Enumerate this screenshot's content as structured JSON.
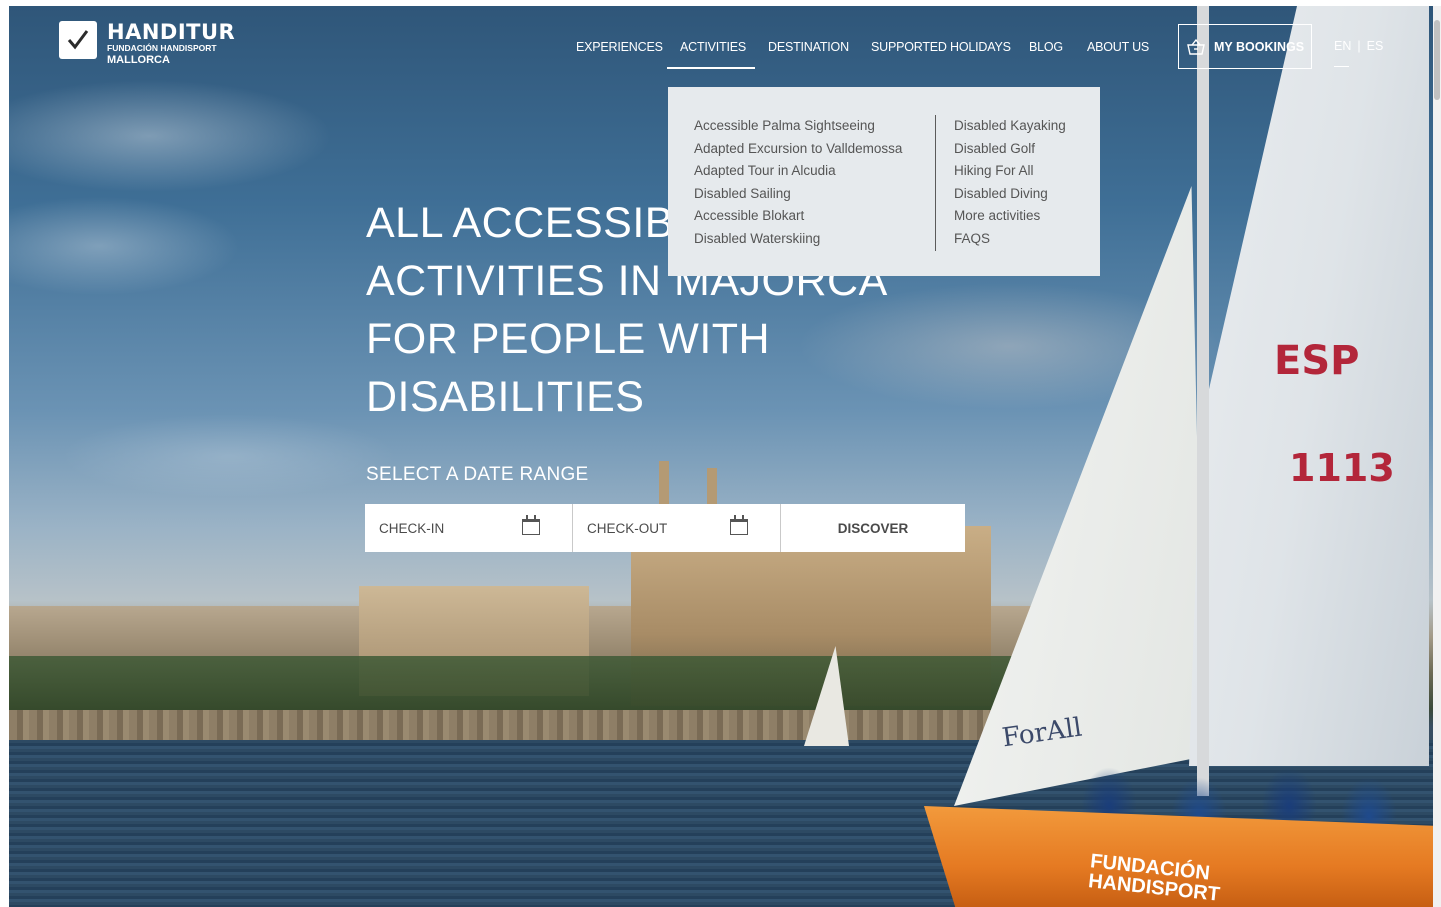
{
  "brand": {
    "name": "HANDITUR",
    "subtitle1": "FUNDACIÓN HANDISPORT",
    "subtitle2": "MALLORCA"
  },
  "nav": {
    "items": [
      {
        "label": "EXPERIENCES"
      },
      {
        "label": "ACTIVITIES"
      },
      {
        "label": "DESTINATION"
      },
      {
        "label": "SUPPORTED HOLIDAYS"
      },
      {
        "label": "BLOG"
      },
      {
        "label": "ABOUT US"
      }
    ],
    "active": "ACTIVITIES",
    "bookings_label": "MY BOOKINGS",
    "lang_en": "EN",
    "lang_sep": "|",
    "lang_es": "ES"
  },
  "dropdown": {
    "left": [
      "Accessible Palma Sightseeing",
      "Adapted Excursion to Valldemossa",
      "Adapted Tour in Alcudia",
      "Disabled Sailing",
      "Accessible Blokart",
      "Disabled Waterskiing"
    ],
    "right": [
      "Disabled Kayaking",
      "Disabled Golf",
      "Hiking For All",
      "Disabled Diving",
      "More activities",
      "FAQS"
    ]
  },
  "hero": {
    "headline_lines": [
      "ALL ACCESSIBLE",
      "ACTIVITIES IN MAJORCA",
      "FOR PEOPLE WITH",
      "DISABILITIES"
    ],
    "select_title": "SELECT A DATE RANGE",
    "checkin_label": "CHECK-IN",
    "checkout_label": "CHECK-OUT",
    "discover_label": "DISCOVER"
  },
  "photo_text": {
    "sail_code": "ESP",
    "sail_number": "1113",
    "jib_text": "ForAll",
    "hull_text_1": "FUNDACIÓN",
    "hull_text_2": "HANDISPORT"
  },
  "colors": {
    "dropdown_bg": "#e6eaed",
    "dropdown_text": "#555555",
    "hull_orange": "#e57a22",
    "sail_red": "#b3263a"
  },
  "icons": {
    "logo": "checkmark-icon",
    "bookings": "basket-icon",
    "date": "calendar-icon"
  }
}
